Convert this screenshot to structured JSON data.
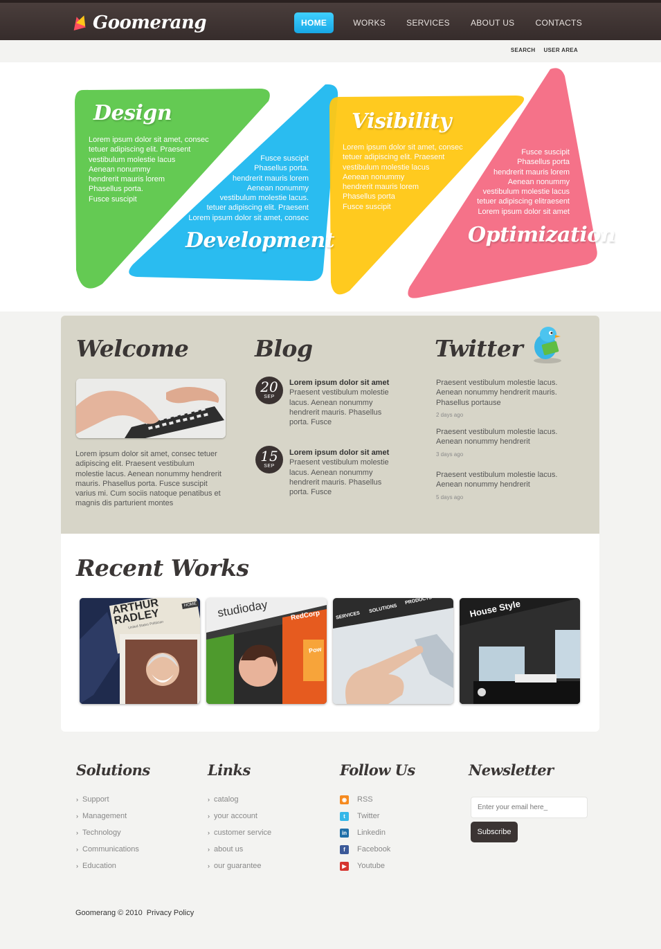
{
  "brand": {
    "name": "Goomerang"
  },
  "nav": {
    "items": [
      {
        "label": "HOME",
        "active": true
      },
      {
        "label": "WORKS",
        "active": false
      },
      {
        "label": "SERVICES",
        "active": false
      },
      {
        "label": "ABOUT US",
        "active": false
      },
      {
        "label": "CONTACTS",
        "active": false
      }
    ],
    "search": "SEARCH",
    "user_area": "USER AREA"
  },
  "banner": {
    "design": {
      "title": "Design",
      "text": [
        "Lorem ipsum dolor sit amet, consec",
        "tetuer adipiscing elit. Praesent",
        "vestibulum molestie lacus",
        "Aenean nonummy",
        "hendrerit mauris lorem",
        "Phasellus porta.",
        "Fusce suscipit"
      ],
      "color": "#5cc74a"
    },
    "development": {
      "title": "Development",
      "text": [
        "Fusce suscipit",
        "Phasellus porta.",
        "hendrerit mauris lorem",
        "Aenean nonummy",
        "vestibulum molestie lacus.",
        "tetuer adipiscing elit. Praesent",
        "Lorem ipsum dolor sit amet, consec"
      ],
      "color": "#1ab7ef"
    },
    "visibility": {
      "title": "Visibility",
      "text": [
        "Lorem ipsum dolor sit amet, consec",
        "tetuer adipiscing elit. Praesent",
        "vestibulum molestie lacus",
        "Aenean nonummy",
        "hendrerit mauris lorem",
        "Phasellus porta",
        "Fusce suscipit"
      ],
      "color": "#ffc713"
    },
    "optimization": {
      "title": "Optimization",
      "text": [
        "Fusce suscipit",
        "Phasellus porta",
        "hendrerit mauris lorem",
        "Aenean nonummy",
        "vestibulum molestie lacus",
        "tetuer adipiscing elitraesent",
        "Lorem ipsum dolor sit amet"
      ],
      "color": "#f4667f"
    }
  },
  "welcome": {
    "title": "Welcome",
    "image_icon": "keyboard-hands-photo",
    "text": [
      "Lorem ipsum dolor sit amet, consec tetuer",
      "adipiscing elit. Praesent vestibulum",
      "molestie lacus. Aenean nonummy hendrerit",
      "mauris. Phasellus porta. Fusce suscipit",
      "varius mi. Cum sociis natoque penatibus et",
      "magnis dis parturient montes"
    ]
  },
  "blog": {
    "title": "Blog",
    "posts": [
      {
        "day": "20",
        "month": "SEP",
        "title": "Lorem ipsum dolor sit amet",
        "text": [
          "Praesent vestibulum molestie",
          "lacus. Aenean nonummy",
          "hendrerit mauris. Phasellus",
          "porta. Fusce"
        ]
      },
      {
        "day": "15",
        "month": "SEP",
        "title": "Lorem ipsum dolor sit amet",
        "text": [
          "Praesent vestibulum molestie",
          "lacus. Aenean nonummy",
          "hendrerit mauris. Phasellus",
          "porta. Fusce"
        ]
      }
    ]
  },
  "twitter": {
    "title": "Twitter",
    "mascot_icon": "twitter-bird-icon",
    "tweets": [
      {
        "text": [
          "Praesent vestibulum molestie lacus.",
          "Aenean nonummy hendrerit mauris.",
          "Phasellus portause"
        ],
        "ago": "2 days ago"
      },
      {
        "text": [
          "Praesent vestibulum molestie lacus.",
          "Aenean nonummy hendrerit"
        ],
        "ago": "3 days ago"
      },
      {
        "text": [
          "Praesent vestibulum molestie lacus.",
          "Aenean nonummy hendrerit"
        ],
        "ago": "5 days ago"
      }
    ]
  },
  "recent_works": {
    "title": "Recent Works",
    "items": [
      {
        "caption": "ARTHUR RADLEY",
        "tag": "HOME",
        "sub": "United States Politician"
      },
      {
        "caption": "studioday",
        "tag": "RedCorp",
        "sub": "Pow"
      },
      {
        "caption": "SERVICES",
        "tag": "SOLUTIONS",
        "sub": "PRODUCTS"
      },
      {
        "caption": "House Style",
        "tag": "",
        "sub": ""
      }
    ]
  },
  "footer": {
    "solutions": {
      "title": "Solutions",
      "items": [
        "Support",
        "Management",
        "Technology",
        "Communications",
        "Education"
      ]
    },
    "links": {
      "title": "Links",
      "items": [
        "catalog",
        "your account",
        "customer service",
        "about us",
        "our guarantee"
      ]
    },
    "follow": {
      "title": "Follow Us",
      "items": [
        {
          "label": "RSS",
          "icon": "rss-icon",
          "color": "#f58a1f"
        },
        {
          "label": "Twitter",
          "icon": "twitter-icon",
          "color": "#35b7e8"
        },
        {
          "label": "Linkedin",
          "icon": "linkedin-icon",
          "color": "#1f6fa8"
        },
        {
          "label": "Facebook",
          "icon": "facebook-icon",
          "color": "#3b5998"
        },
        {
          "label": "Youtube",
          "icon": "youtube-icon",
          "color": "#d6352f"
        }
      ]
    },
    "newsletter": {
      "title": "Newsletter",
      "placeholder": "Enter your email here_",
      "button": "Subscribe"
    },
    "copyright": "Goomerang © 2010",
    "privacy": "Privacy Policy"
  },
  "colors": {
    "header": "#3f3433",
    "nav_active": "#22b4ee",
    "panel": "#d7d5c8"
  }
}
